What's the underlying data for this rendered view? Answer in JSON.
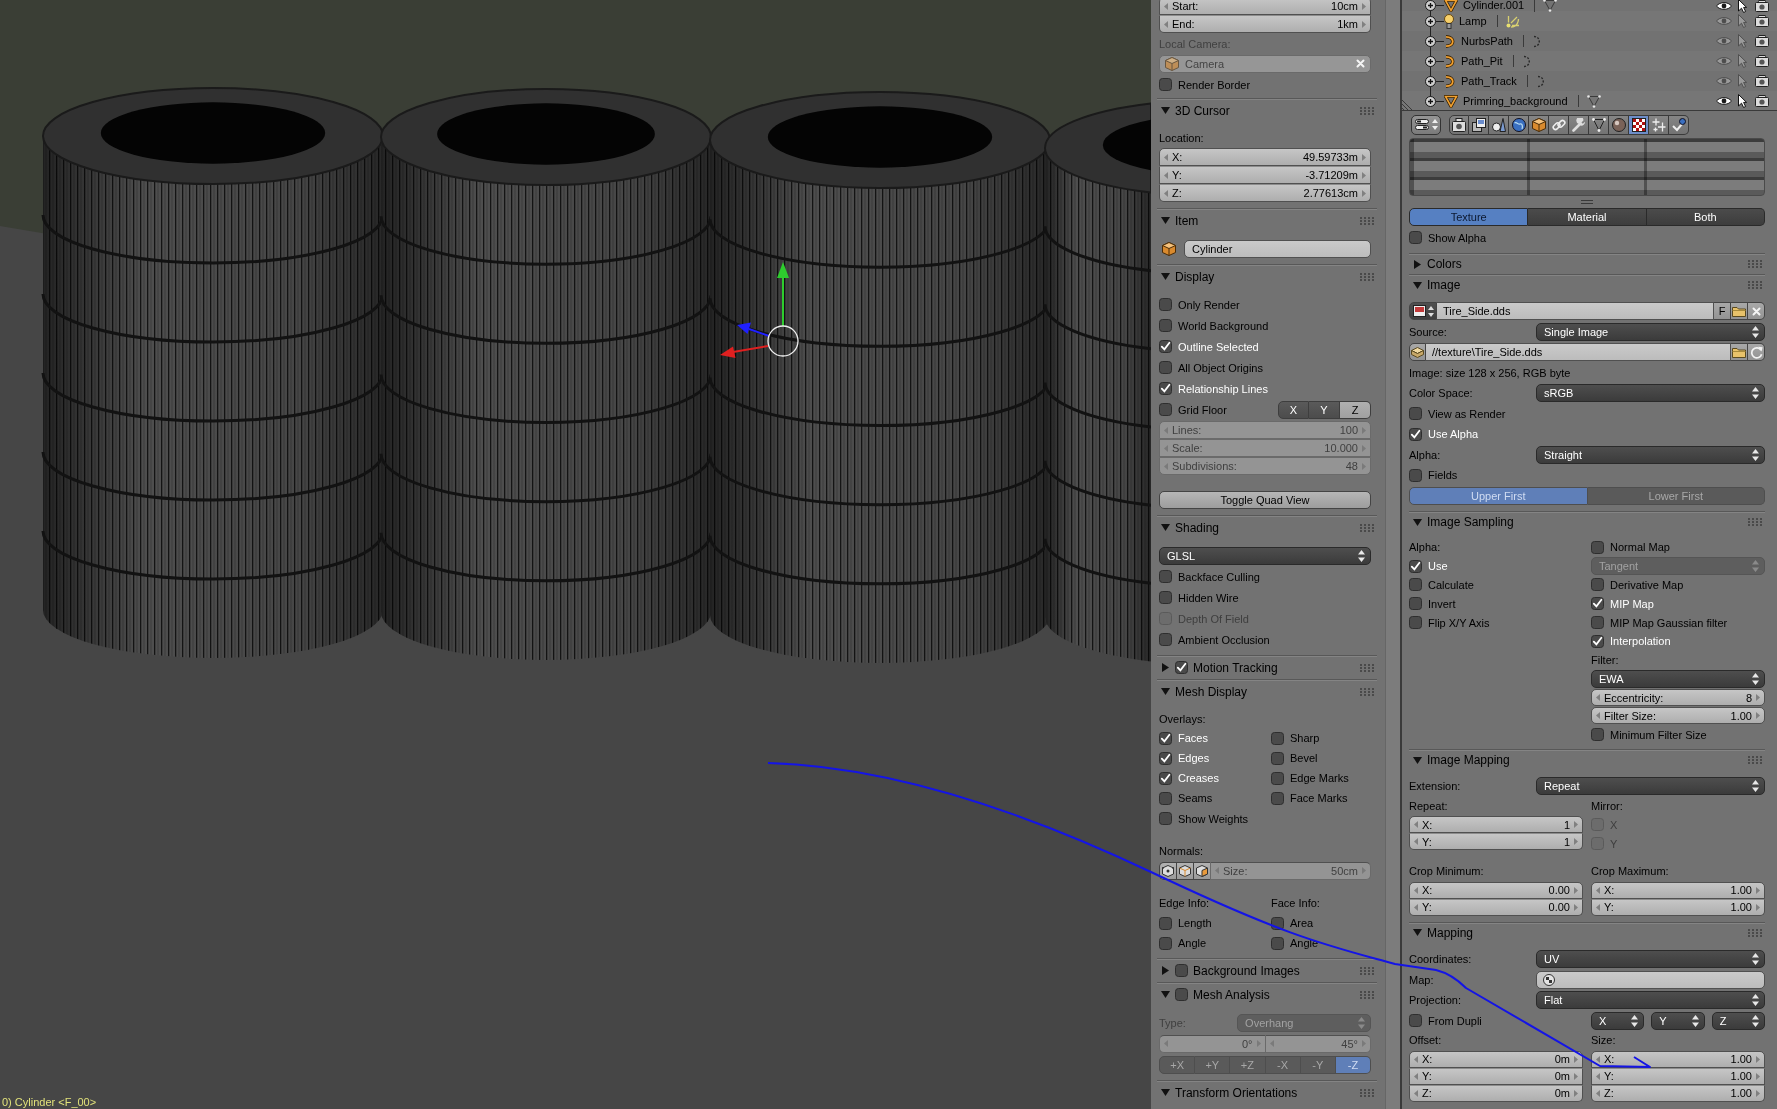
{
  "viewport": {
    "status_text": "0) Cylinder <F_00>"
  },
  "view_panel": {
    "sections": [
      {
        "rows": [
          {
            "kind": "numbers",
            "fields": [
              {
                "label": "Start:",
                "value": "10cm",
                "disabled": false
              },
              {
                "label": "End:",
                "value": "1km",
                "disabled": false
              }
            ]
          },
          {
            "kind": "label",
            "text": "Local Camera:",
            "disabled": true
          },
          {
            "kind": "object",
            "value": "Camera",
            "disabled": true
          },
          {
            "kind": "check",
            "label": "Render Border",
            "checked": false,
            "disabled": false
          }
        ]
      },
      {
        "title": "3D Cursor",
        "expanded": true,
        "rows": [
          {
            "kind": "label",
            "text": "Location:",
            "disabled": false
          },
          {
            "kind": "numbers",
            "fields": [
              {
                "label": "X:",
                "value": "49.59733m",
                "disabled": false
              },
              {
                "label": "Y:",
                "value": "-3.71209m",
                "disabled": false
              },
              {
                "label": "Z:",
                "value": "2.77613cm",
                "disabled": false
              }
            ]
          }
        ]
      },
      {
        "title": "Item",
        "expanded": true,
        "rows": [
          {
            "kind": "name",
            "value": "Cylinder"
          }
        ]
      },
      {
        "title": "Display",
        "expanded": true,
        "rows": [
          {
            "kind": "check",
            "label": "Only Render",
            "checked": false,
            "disabled": false
          },
          {
            "kind": "check",
            "label": "World Background",
            "checked": false,
            "disabled": false
          },
          {
            "kind": "check",
            "label": "Outline Selected",
            "checked": true,
            "disabled": false
          },
          {
            "kind": "check",
            "label": "All Object Origins",
            "checked": false,
            "disabled": false
          },
          {
            "kind": "check",
            "label": "Relationship Lines",
            "checked": true,
            "disabled": false
          },
          {
            "kind": "check_axes",
            "label": "Grid Floor",
            "checked": false,
            "axes": [
              {
                "label": "X",
                "selected": true
              },
              {
                "label": "Y",
                "selected": true
              },
              {
                "label": "Z",
                "selected": false
              }
            ]
          },
          {
            "kind": "numbers",
            "fields": [
              {
                "label": "Lines:",
                "value": "100",
                "disabled": true
              },
              {
                "label": "Scale:",
                "value": "10.000",
                "disabled": true
              },
              {
                "label": "Subdivisions:",
                "value": "48",
                "disabled": true
              }
            ]
          },
          {
            "kind": "button",
            "label": "Toggle Quad View"
          }
        ]
      },
      {
        "title": "Shading",
        "expanded": true,
        "rows": [
          {
            "kind": "dropdown",
            "value": "GLSL",
            "disabled": false
          },
          {
            "kind": "check",
            "label": "Backface Culling",
            "checked": false,
            "disabled": false
          },
          {
            "kind": "check",
            "label": "Hidden Wire",
            "checked": false,
            "disabled": false
          },
          {
            "kind": "check",
            "label": "Depth Of Field",
            "checked": false,
            "disabled": true
          },
          {
            "kind": "check",
            "label": "Ambient Occlusion",
            "checked": false,
            "disabled": false
          }
        ]
      },
      {
        "title": "Motion Tracking",
        "expanded": false,
        "checked": true
      },
      {
        "title": "Mesh Display",
        "expanded": true,
        "rows": [
          {
            "kind": "label",
            "text": "Overlays:",
            "disabled": false
          },
          {
            "kind": "columns",
            "columns": [
              [
                {
                  "kind": "check",
                  "label": "Faces",
                  "checked": true,
                  "disabled": false
                },
                {
                  "kind": "check",
                  "label": "Edges",
                  "checked": true,
                  "disabled": false
                },
                {
                  "kind": "check",
                  "label": "Creases",
                  "checked": true,
                  "disabled": false
                },
                {
                  "kind": "check",
                  "label": "Seams",
                  "checked": false,
                  "disabled": false
                }
              ],
              [
                {
                  "kind": "check",
                  "label": "Sharp",
                  "checked": false,
                  "disabled": false
                },
                {
                  "kind": "check",
                  "label": "Bevel",
                  "checked": false,
                  "disabled": false
                },
                {
                  "kind": "check",
                  "label": "Edge Marks",
                  "checked": false,
                  "disabled": false
                },
                {
                  "kind": "check",
                  "label": "Face Marks",
                  "checked": false,
                  "disabled": false
                }
              ]
            ]
          },
          {
            "kind": "check",
            "label": "Show Weights",
            "checked": false,
            "disabled": false
          },
          {
            "kind": "label",
            "text": "Normals:",
            "disabled": false
          },
          {
            "kind": "normals",
            "field": {
              "label": "Size:",
              "value": "50cm",
              "disabled": true
            }
          },
          {
            "kind": "columns",
            "columns": [
              [
                {
                  "kind": "label",
                  "text": "Edge Info:",
                  "disabled": false
                },
                {
                  "kind": "check",
                  "label": "Length",
                  "checked": false,
                  "disabled": false
                },
                {
                  "kind": "check",
                  "label": "Angle",
                  "checked": false,
                  "disabled": false
                }
              ],
              [
                {
                  "kind": "label",
                  "text": "Face Info:",
                  "disabled": false
                },
                {
                  "kind": "check",
                  "label": "Area",
                  "checked": false,
                  "disabled": false
                },
                {
                  "kind": "check",
                  "label": "Angle",
                  "checked": false,
                  "disabled": false
                }
              ]
            ]
          }
        ]
      },
      {
        "title": "Background Images",
        "expanded": false,
        "checked": false
      },
      {
        "title": "Mesh Analysis",
        "expanded": true,
        "checked": false,
        "rows": [
          {
            "kind": "dropdown",
            "label": "Type:",
            "value": "Overhang",
            "disabled": true
          },
          {
            "kind": "number_row",
            "fields": [
              {
                "value": "0°",
                "disabled": true
              },
              {
                "value": "45°",
                "disabled": true
              }
            ]
          },
          {
            "kind": "radio",
            "disabled": true,
            "items": [
              {
                "label": "+X",
                "selected": false
              },
              {
                "label": "+Y",
                "selected": false
              },
              {
                "label": "+Z",
                "selected": false
              },
              {
                "label": "-X",
                "selected": false
              },
              {
                "label": "-Y",
                "selected": false
              },
              {
                "label": "-Z",
                "selected": true
              }
            ]
          }
        ]
      },
      {
        "title": "Transform Orientations",
        "expanded": true
      }
    ]
  },
  "outliner": {
    "items": [
      {
        "name": "Cylinder.001",
        "kind": "mesh",
        "visible": true,
        "selectable": true
      },
      {
        "name": "Lamp",
        "kind": "lamp",
        "visible": false,
        "selectable": false
      },
      {
        "name": "NurbsPath",
        "kind": "curve",
        "visible": false,
        "selectable": false
      },
      {
        "name": "Path_Pit",
        "kind": "curve",
        "visible": false,
        "selectable": false
      },
      {
        "name": "Path_Track",
        "kind": "curve",
        "visible": false,
        "selectable": false
      },
      {
        "name": "Primring_background",
        "kind": "mesh",
        "visible": true,
        "selectable": true
      }
    ]
  },
  "properties": {
    "tabs": [
      {
        "kind": "render",
        "selected": false
      },
      {
        "kind": "render_layers",
        "selected": false
      },
      {
        "kind": "scene",
        "selected": false
      },
      {
        "kind": "world",
        "selected": false
      },
      {
        "kind": "object",
        "selected": false
      },
      {
        "kind": "constraints",
        "selected": false
      },
      {
        "kind": "modifiers",
        "selected": false
      },
      {
        "kind": "mesh_data",
        "selected": false
      },
      {
        "kind": "material",
        "selected": false
      },
      {
        "kind": "texture",
        "selected": true
      },
      {
        "kind": "particles",
        "selected": false
      },
      {
        "kind": "physics",
        "selected": false
      }
    ]
  },
  "texture_panel": {
    "sections": [
      {
        "rows": [
          {
            "kind": "preview"
          },
          {
            "kind": "radio",
            "disabled": false,
            "items": [
              {
                "label": "Texture",
                "selected": true
              },
              {
                "label": "Material",
                "selected": false
              },
              {
                "label": "Both",
                "selected": false
              }
            ]
          },
          {
            "kind": "check",
            "label": "Show Alpha",
            "checked": false,
            "disabled": false
          }
        ]
      },
      {
        "title": "Colors",
        "expanded": false
      },
      {
        "title": "Image",
        "expanded": true,
        "rows": [
          {
            "kind": "image_block",
            "value": "Tire_Side.dds",
            "button": "F"
          },
          {
            "kind": "dropdown",
            "label": "Source:",
            "value": "Single Image",
            "disabled": false
          },
          {
            "kind": "file_path",
            "value": "//texture\\Tire_Side.dds"
          },
          {
            "kind": "label",
            "text": "Image: size 128 x 256, RGB byte",
            "disabled": false
          },
          {
            "kind": "dropdown",
            "label": "Color Space:",
            "value": "sRGB",
            "disabled": false
          },
          {
            "kind": "check",
            "label": "View as Render",
            "checked": false,
            "disabled": false
          },
          {
            "kind": "check",
            "label": "Use Alpha",
            "checked": true,
            "disabled": false
          },
          {
            "kind": "dropdown",
            "label": "Alpha:",
            "value": "Straight",
            "disabled": false
          },
          {
            "kind": "check",
            "label": "Fields",
            "checked": false,
            "disabled": false
          },
          {
            "kind": "radio",
            "disabled": true,
            "items": [
              {
                "label": "Upper First",
                "selected": true
              },
              {
                "label": "Lower First",
                "selected": false
              }
            ]
          }
        ]
      },
      {
        "title": "Image Sampling",
        "expanded": true,
        "rows": [
          {
            "kind": "columns",
            "columns": [
              [
                {
                  "kind": "label",
                  "text": "Alpha:",
                  "disabled": false
                },
                {
                  "kind": "check",
                  "label": "Use",
                  "checked": true,
                  "disabled": false
                },
                {
                  "kind": "check",
                  "label": "Calculate",
                  "checked": false,
                  "disabled": false
                },
                {
                  "kind": "check",
                  "label": "Invert",
                  "checked": false,
                  "disabled": false
                },
                {
                  "kind": "check",
                  "label": "Flip X/Y Axis",
                  "checked": false,
                  "disabled": false
                }
              ],
              [
                {
                  "kind": "check",
                  "label": "Normal Map",
                  "checked": false,
                  "disabled": false
                },
                {
                  "kind": "dropdown",
                  "value": "Tangent",
                  "disabled": true
                },
                {
                  "kind": "check",
                  "label": "Derivative Map",
                  "checked": false,
                  "disabled": false
                },
                {
                  "kind": "check",
                  "label": "MIP Map",
                  "checked": true,
                  "disabled": false
                },
                {
                  "kind": "check",
                  "label": "MIP Map Gaussian filter",
                  "checked": false,
                  "disabled": false
                },
                {
                  "kind": "check",
                  "label": "Interpolation",
                  "checked": true,
                  "disabled": false
                },
                {
                  "kind": "label",
                  "text": "Filter:",
                  "disabled": false
                },
                {
                  "kind": "dropdown",
                  "value": "EWA",
                  "disabled": false
                },
                {
                  "kind": "numbers",
                  "fields": [
                    {
                      "label": "Eccentricity:",
                      "value": "8",
                      "disabled": false
                    }
                  ]
                },
                {
                  "kind": "numbers",
                  "fields": [
                    {
                      "label": "Filter Size:",
                      "value": "1.00",
                      "disabled": false
                    }
                  ]
                },
                {
                  "kind": "check",
                  "label": "Minimum Filter Size",
                  "checked": false,
                  "disabled": false
                }
              ]
            ]
          }
        ]
      },
      {
        "title": "Image Mapping",
        "expanded": true,
        "rows": [
          {
            "kind": "dropdown",
            "label": "Extension:",
            "value": "Repeat",
            "disabled": false
          },
          {
            "kind": "columns",
            "columns": [
              [
                {
                  "kind": "label",
                  "text": "Repeat:",
                  "disabled": false
                },
                {
                  "kind": "numbers",
                  "fields": [
                    {
                      "label": "X:",
                      "value": "1",
                      "disabled": false
                    },
                    {
                      "label": "Y:",
                      "value": "1",
                      "disabled": false
                    }
                  ]
                }
              ],
              [
                {
                  "kind": "label",
                  "text": "Mirror:",
                  "disabled": false
                },
                {
                  "kind": "check",
                  "label": "X",
                  "checked": false,
                  "disabled": true
                },
                {
                  "kind": "check",
                  "label": "Y",
                  "checked": false,
                  "disabled": true
                }
              ]
            ]
          },
          {
            "kind": "columns",
            "columns": [
              [
                {
                  "kind": "label",
                  "text": "Crop Minimum:",
                  "disabled": false
                },
                {
                  "kind": "numbers",
                  "fields": [
                    {
                      "label": "X:",
                      "value": "0.00",
                      "disabled": false
                    },
                    {
                      "label": "Y:",
                      "value": "0.00",
                      "disabled": false
                    }
                  ]
                }
              ],
              [
                {
                  "kind": "label",
                  "text": "Crop Maximum:",
                  "disabled": false
                },
                {
                  "kind": "numbers",
                  "fields": [
                    {
                      "label": "X:",
                      "value": "1.00",
                      "disabled": false
                    },
                    {
                      "label": "Y:",
                      "value": "1.00",
                      "disabled": false
                    }
                  ]
                }
              ]
            ]
          }
        ]
      },
      {
        "title": "Mapping",
        "expanded": true,
        "rows": [
          {
            "kind": "dropdown",
            "label": "Coordinates:",
            "value": "UV",
            "disabled": false
          },
          {
            "kind": "search_field",
            "label": "Map:"
          },
          {
            "kind": "dropdown",
            "label": "Projection:",
            "value": "Flat",
            "disabled": false
          },
          {
            "kind": "check_dropdowns",
            "label": "From Dupli",
            "checked": false,
            "values": [
              "X",
              "Y",
              "Z"
            ]
          },
          {
            "kind": "columns",
            "columns": [
              [
                {
                  "kind": "label",
                  "text": "Offset:",
                  "disabled": false
                },
                {
                  "kind": "numbers",
                  "fields": [
                    {
                      "label": "X:",
                      "value": "0m",
                      "disabled": false
                    },
                    {
                      "label": "Y:",
                      "value": "0m",
                      "disabled": false
                    },
                    {
                      "label": "Z:",
                      "value": "0m",
                      "disabled": false
                    }
                  ]
                }
              ],
              [
                {
                  "kind": "label",
                  "text": "Size:",
                  "disabled": false
                },
                {
                  "kind": "numbers",
                  "fields": [
                    {
                      "label": "X:",
                      "value": "1.00",
                      "disabled": false
                    },
                    {
                      "label": "Y:",
                      "value": "1.00",
                      "disabled": false
                    },
                    {
                      "label": "Z:",
                      "value": "1.00",
                      "disabled": false
                    }
                  ]
                }
              ]
            ]
          }
        ]
      }
    ]
  }
}
